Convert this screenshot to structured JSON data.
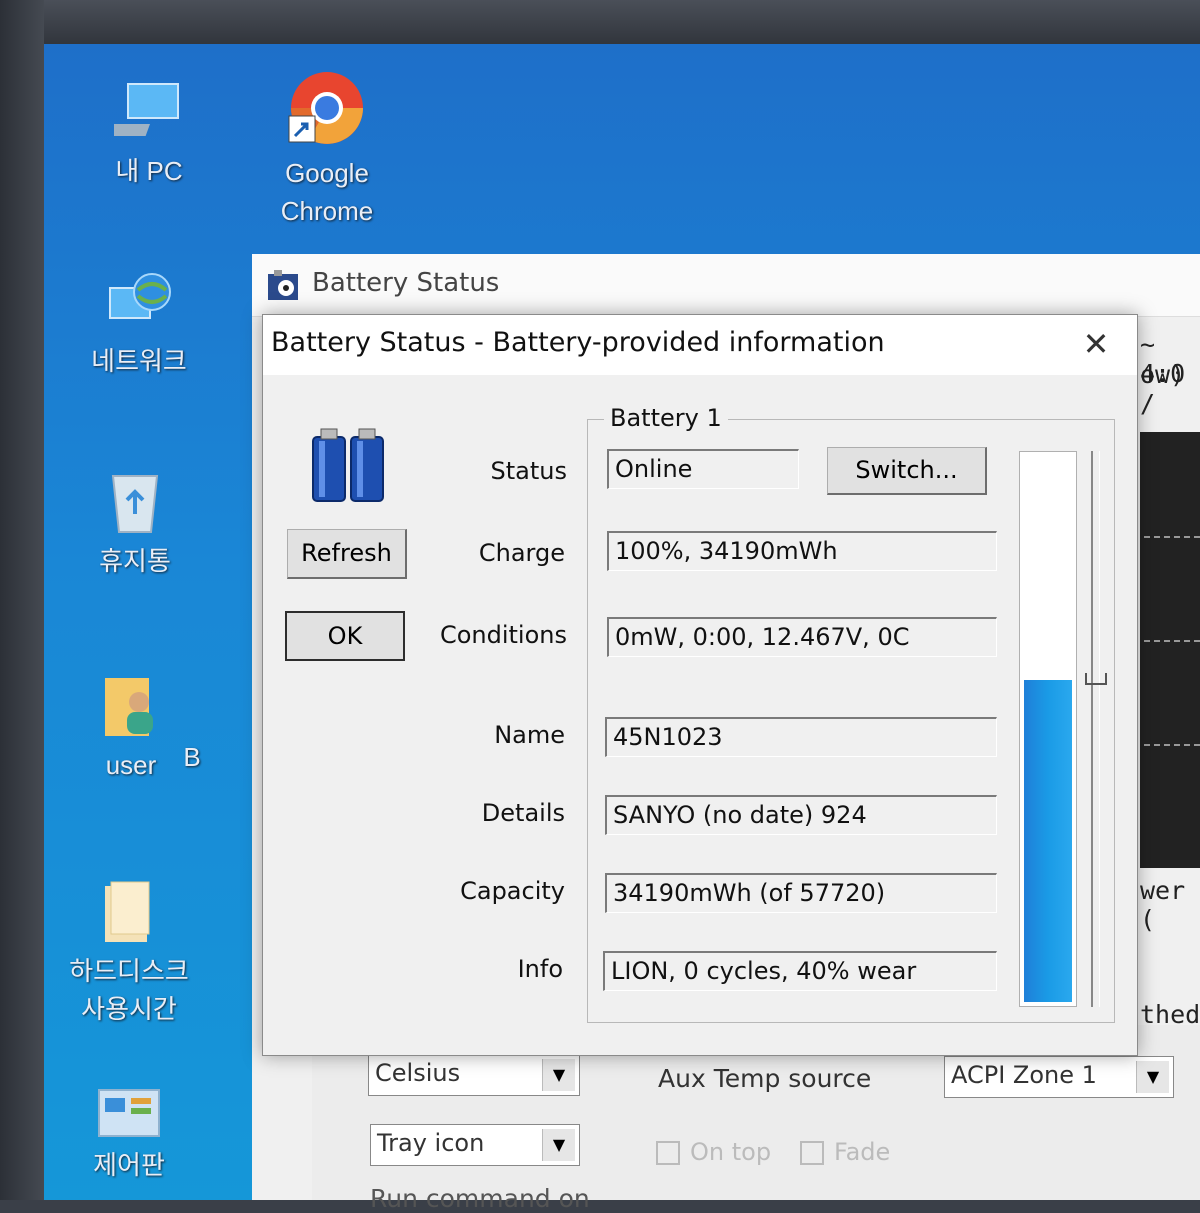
{
  "desktop": {
    "icons": [
      {
        "label": "내 PC",
        "icon": "computer-icon"
      },
      {
        "label": "Google\nChrome",
        "icon": "chrome-icon"
      },
      {
        "label": "네트워크",
        "icon": "network-icon"
      },
      {
        "label": "휴지통",
        "icon": "recycle-bin-icon"
      },
      {
        "label": "user",
        "icon": "user-folder-icon"
      },
      {
        "label": "하드디스크\n사용시간",
        "icon": "folder-icon"
      },
      {
        "label": "제어판",
        "icon": "control-panel-icon"
      }
    ],
    "partial_label": "B"
  },
  "background_app": {
    "title": "Battery Status",
    "right_fragments": [
      "~ 4:0",
      "ow) /",
      "wer (",
      "thed"
    ],
    "temp_unit": "Celsius",
    "aux_temp_label": "Aux Temp source",
    "aux_temp_value": "ACPI Zone 1",
    "display_mode": "Tray icon",
    "on_top_label": "On top",
    "fade_label": "Fade",
    "run_command_partial": "Run command on"
  },
  "dialog": {
    "title": "Battery Status - Battery-provided information",
    "close_symbol": "✕",
    "refresh_label": "Refresh",
    "ok_label": "OK",
    "group_title": "Battery 1",
    "switch_label": "Switch...",
    "labels": {
      "status": "Status",
      "charge": "Charge",
      "conditions": "Conditions",
      "name": "Name",
      "details": "Details",
      "capacity": "Capacity",
      "info": "Info"
    },
    "values": {
      "status": "Online",
      "charge": "100%, 34190mWh",
      "conditions": "0mW, 0:00, 12.467V, 0C",
      "name": "45N1023",
      "details": "SANYO (no date)   924",
      "capacity": "34190mWh (of 57720)",
      "info": "LION, 0 cycles, 40% wear"
    },
    "charge_level": 0.59,
    "accent_color": "#1a9be6"
  }
}
